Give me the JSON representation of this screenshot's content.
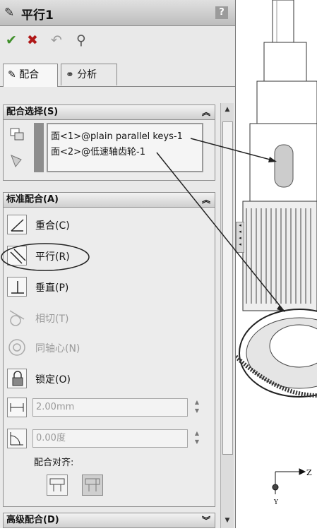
{
  "title": {
    "text": "平行1",
    "icon": "mate-icon",
    "help": "?"
  },
  "actions": [
    {
      "name": "ok-button",
      "glyph": "✔"
    },
    {
      "name": "cancel-button",
      "glyph": "✖"
    },
    {
      "name": "undo-button",
      "glyph": "↶"
    },
    {
      "name": "pin-button",
      "glyph": "⚲"
    }
  ],
  "tabs": [
    {
      "label": "配合",
      "icon": "mate-icon"
    },
    {
      "label": "分析",
      "icon": "analysis-icon"
    }
  ],
  "mate_selection": {
    "header": "配合选择(S)",
    "items": [
      "面<1>@plain parallel keys-1",
      "面<2>@低速轴齿轮-1"
    ]
  },
  "standard_mates": {
    "header": "标准配合(A)",
    "items": [
      {
        "label": "重合(C)",
        "icon": "coincident-icon",
        "enabled": true
      },
      {
        "label": "平行(R)",
        "icon": "parallel-icon",
        "enabled": true,
        "selected": true
      },
      {
        "label": "垂直(P)",
        "icon": "perpendicular-icon",
        "enabled": true
      },
      {
        "label": "相切(T)",
        "icon": "tangent-icon",
        "enabled": false
      },
      {
        "label": "同轴心(N)",
        "icon": "concentric-icon",
        "enabled": false
      },
      {
        "label": "锁定(O)",
        "icon": "lock-icon",
        "enabled": true
      }
    ],
    "distance": "2.00mm",
    "angle": "0.00度",
    "alignment_label": "配合对齐:"
  },
  "advanced_mates": {
    "header": "高级配合(D)"
  },
  "axis": {
    "z": "Z",
    "y": "Y"
  },
  "colors": {
    "panel": "#e9e9e9",
    "header": "#cfcfcf",
    "annotation": "#222222"
  }
}
